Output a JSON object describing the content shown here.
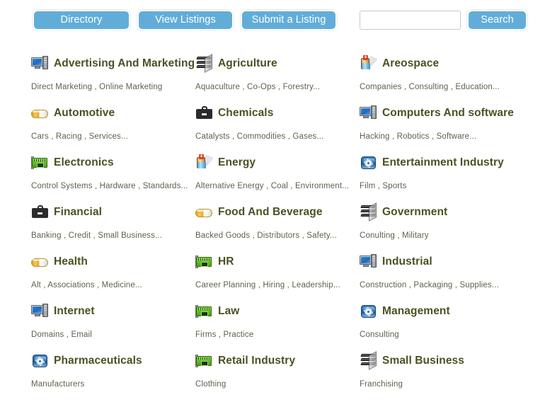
{
  "toolbar": {
    "directory_label": "Directory",
    "view_listings_label": "View Listings",
    "submit_listing_label": "Submit a Listing",
    "search_button_label": "Search",
    "search_value": "",
    "search_placeholder": ""
  },
  "categories": [
    {
      "title": "Advertising And Marketing",
      "subs": "Direct Marketing , Online Marketing",
      "icon": "computer-icon"
    },
    {
      "title": "Agriculture",
      "subs": "Aquaculture , Co-Ops , Forestry...",
      "icon": "stacked-layers-icon"
    },
    {
      "title": "Areospace",
      "subs": "Companies , Consulting , Education...",
      "icon": "battery-bolt-icon"
    },
    {
      "title": "Automotive",
      "subs": "Cars , Racing , Services...",
      "icon": "capsule-icon"
    },
    {
      "title": "Chemicals",
      "subs": "Catalysts , Commodities , Gases...",
      "icon": "briefcase-icon"
    },
    {
      "title": "Computers And software",
      "subs": "Hacking , Robotics , Software...",
      "icon": "computer-icon"
    },
    {
      "title": "Electronics",
      "subs": "Control Systems , Hardware , Standards...",
      "icon": "circuit-card-icon"
    },
    {
      "title": "Energy",
      "subs": "Alternative Energy , Coal , Environment...",
      "icon": "battery-bolt-icon"
    },
    {
      "title": "Entertainment Industry",
      "subs": "Film , Sports",
      "icon": "gear-plate-icon"
    },
    {
      "title": "Financial",
      "subs": "Banking , Credit , Small Business...",
      "icon": "briefcase-icon"
    },
    {
      "title": "Food And Beverage",
      "subs": "Backed Goods , Distributors , Safety...",
      "icon": "capsule-icon"
    },
    {
      "title": "Government",
      "subs": "Conulting , Military",
      "icon": "stacked-layers-icon"
    },
    {
      "title": "Health",
      "subs": "Alt , Associations , Medicine...",
      "icon": "capsule-icon"
    },
    {
      "title": "HR",
      "subs": "Career Planning , Hiring , Leadership...",
      "icon": "circuit-card-icon"
    },
    {
      "title": "Industrial",
      "subs": "Construction , Packaging , Supplies...",
      "icon": "computer-icon"
    },
    {
      "title": "Internet",
      "subs": "Domains , Email",
      "icon": "computer-icon"
    },
    {
      "title": "Law",
      "subs": "Firms , Practice",
      "icon": "circuit-card-icon"
    },
    {
      "title": "Management",
      "subs": "Consulting",
      "icon": "gear-plate-icon"
    },
    {
      "title": "Pharmaceuticals",
      "subs": "Manufacturers",
      "icon": "gear-plate-icon"
    },
    {
      "title": "Retail Industry",
      "subs": "Clothing",
      "icon": "circuit-card-icon"
    },
    {
      "title": "Small Business",
      "subs": "Franchising",
      "icon": "stacked-layers-icon"
    }
  ],
  "colors": {
    "button_blue": "#62add8",
    "title_olive": "#4a5122",
    "sub_text": "#5f5f4e"
  }
}
